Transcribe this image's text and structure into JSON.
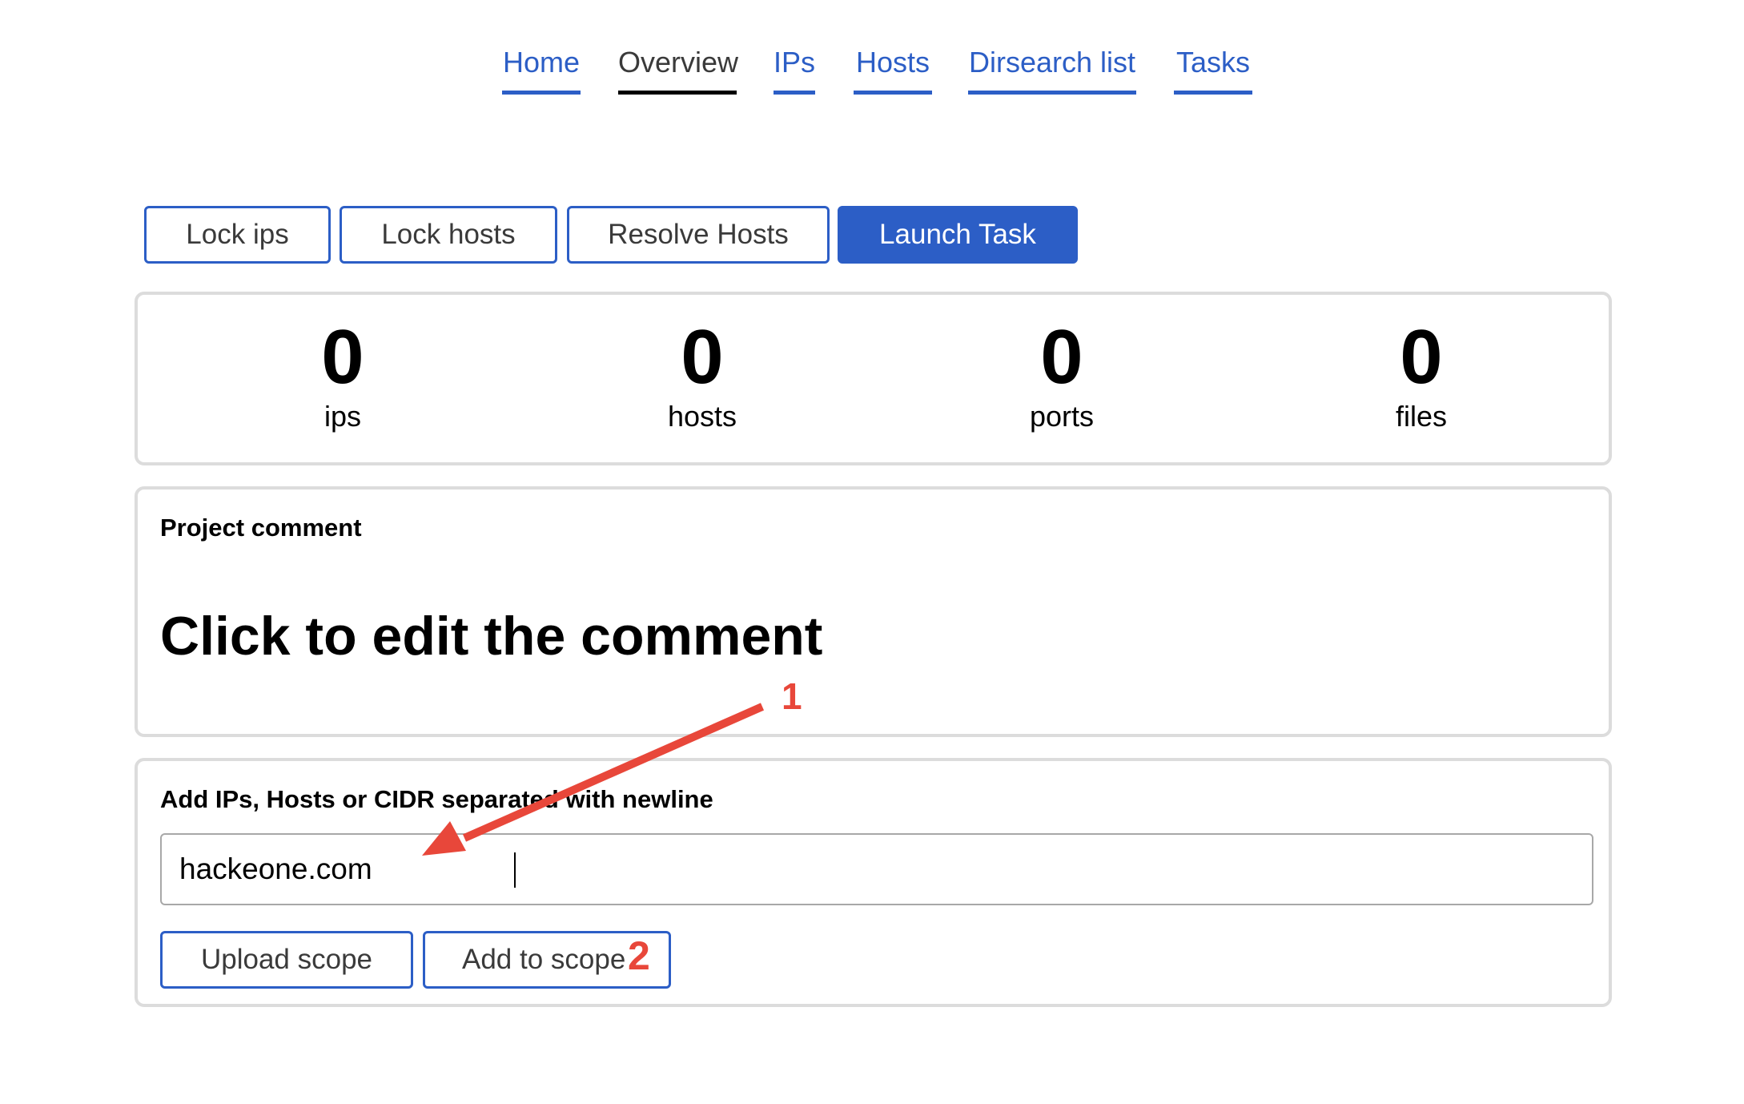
{
  "nav": {
    "items": [
      {
        "label": "Home",
        "active": false
      },
      {
        "label": "Overview",
        "active": true
      },
      {
        "label": "IPs",
        "active": false
      },
      {
        "label": "Hosts",
        "active": false
      },
      {
        "label": "Dirsearch list",
        "active": false
      },
      {
        "label": "Tasks",
        "active": false
      }
    ]
  },
  "actions": {
    "lock_ips": "Lock ips",
    "lock_hosts": "Lock hosts",
    "resolve_hosts": "Resolve Hosts",
    "launch_task": "Launch Task"
  },
  "stats": [
    {
      "value": "0",
      "label": "ips"
    },
    {
      "value": "0",
      "label": "hosts"
    },
    {
      "value": "0",
      "label": "ports"
    },
    {
      "value": "0",
      "label": "files"
    }
  ],
  "comment": {
    "title": "Project comment",
    "text": "Click to edit the comment"
  },
  "scope": {
    "title": "Add IPs, Hosts or CIDR separated with newline",
    "input_value": "hackeone.com",
    "upload_label": "Upload scope",
    "add_label": "Add to scope"
  },
  "annotations": {
    "step1": "1",
    "step2": "2",
    "color": "#e8473a"
  },
  "colors": {
    "accent": "#2c5ec6",
    "border": "#dcdcdc"
  }
}
